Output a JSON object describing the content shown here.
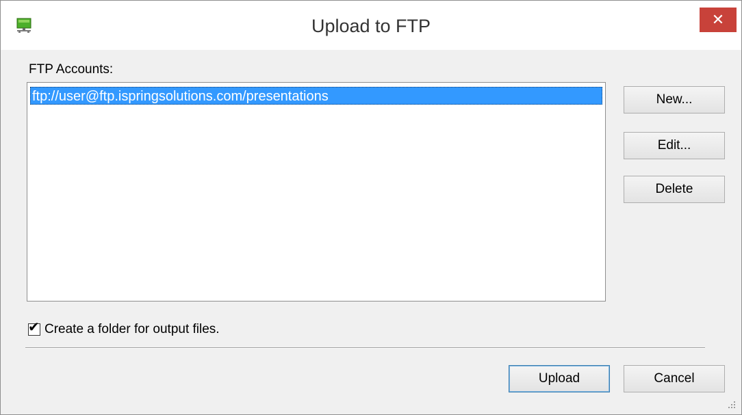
{
  "window": {
    "title": "Upload to FTP",
    "close_label": "✕"
  },
  "accounts": {
    "label": "FTP Accounts:",
    "items": [
      "ftp://user@ftp.ispringsolutions.com/presentations"
    ],
    "selected_index": 0
  },
  "side_buttons": {
    "new_label": "New...",
    "edit_label": "Edit...",
    "delete_label": "Delete"
  },
  "options": {
    "create_folder_label": "Create a folder for output files.",
    "create_folder_checked": true
  },
  "footer": {
    "upload_label": "Upload",
    "cancel_label": "Cancel"
  },
  "icons": {
    "app": "network-computer-icon",
    "close": "close-icon",
    "check": "checkmark-icon",
    "grip": "resize-grip-icon"
  },
  "colors": {
    "selection": "#3399ff",
    "close_button": "#c8423a"
  }
}
